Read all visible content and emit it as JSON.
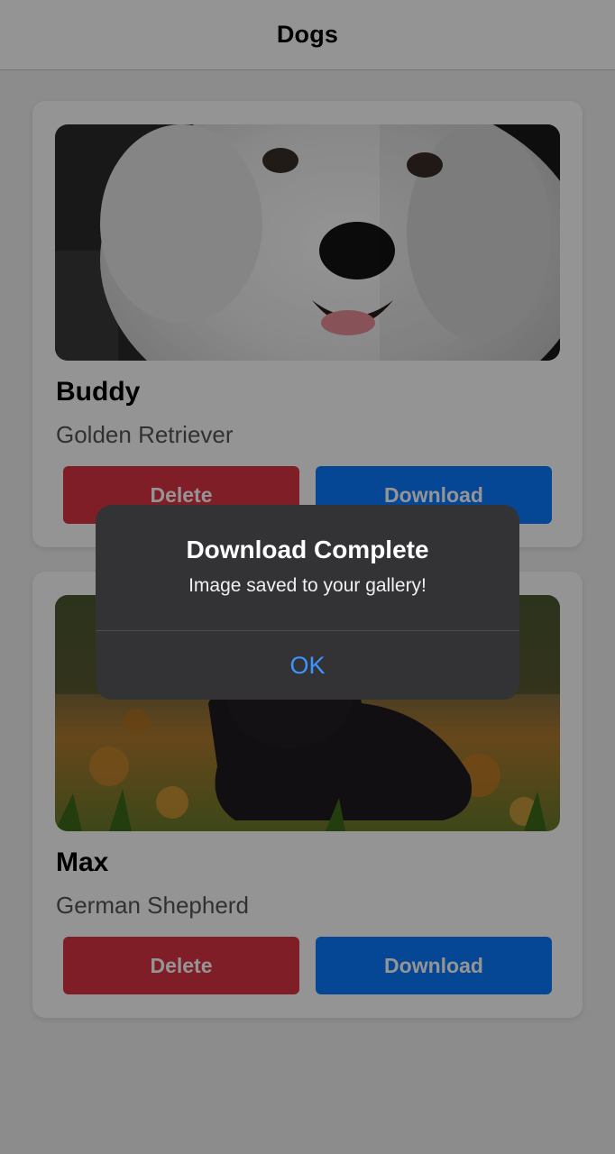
{
  "navbar": {
    "title": "Dogs"
  },
  "dogs": [
    {
      "name": "Buddy",
      "breed": "Golden Retriever",
      "delete_label": "Delete",
      "download_label": "Download"
    },
    {
      "name": "Max",
      "breed": "German Shepherd",
      "delete_label": "Delete",
      "download_label": "Download"
    }
  ],
  "alert": {
    "title": "Download Complete",
    "message": "Image saved to your gallery!",
    "ok_label": "OK"
  },
  "colors": {
    "delete": "#dc3545",
    "download": "#0a7bff",
    "alert_ok": "#3d94ff",
    "alert_bg": "#333335"
  }
}
